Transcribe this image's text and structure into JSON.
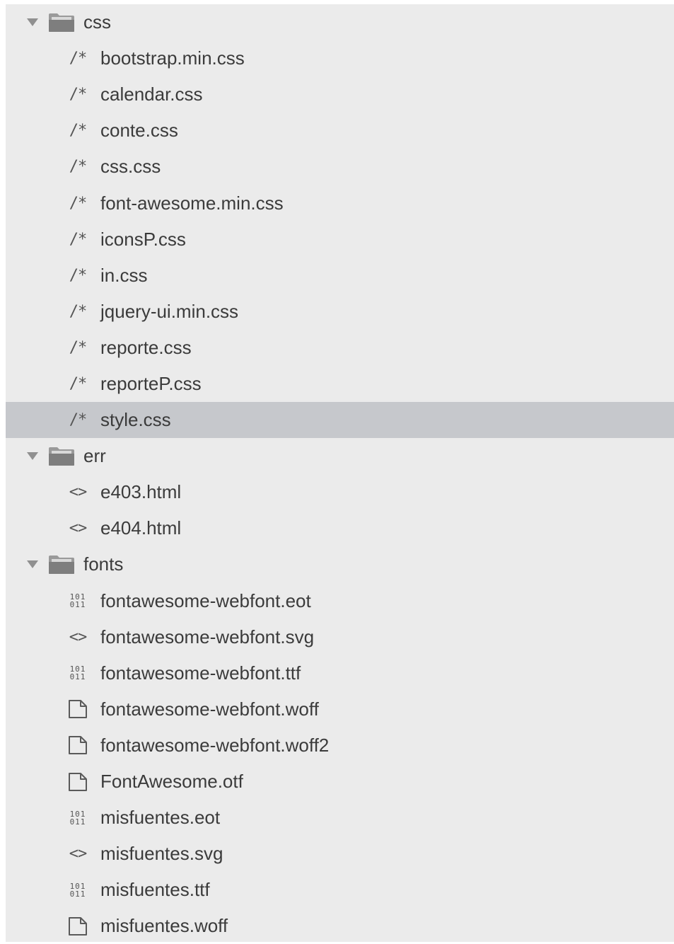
{
  "tree": [
    {
      "kind": "folder",
      "label": "css",
      "icon": "folder-icon",
      "expanded": true
    },
    {
      "kind": "file",
      "label": "bootstrap.min.css",
      "icon": "css-comment-icon",
      "glyph": "/*"
    },
    {
      "kind": "file",
      "label": "calendar.css",
      "icon": "css-comment-icon",
      "glyph": "/*"
    },
    {
      "kind": "file",
      "label": "conte.css",
      "icon": "css-comment-icon",
      "glyph": "/*"
    },
    {
      "kind": "file",
      "label": "css.css",
      "icon": "css-comment-icon",
      "glyph": "/*"
    },
    {
      "kind": "file",
      "label": "font-awesome.min.css",
      "icon": "css-comment-icon",
      "glyph": "/*"
    },
    {
      "kind": "file",
      "label": "iconsP.css",
      "icon": "css-comment-icon",
      "glyph": "/*"
    },
    {
      "kind": "file",
      "label": "in.css",
      "icon": "css-comment-icon",
      "glyph": "/*"
    },
    {
      "kind": "file",
      "label": "jquery-ui.min.css",
      "icon": "css-comment-icon",
      "glyph": "/*"
    },
    {
      "kind": "file",
      "label": "reporte.css",
      "icon": "css-comment-icon",
      "glyph": "/*"
    },
    {
      "kind": "file",
      "label": "reporteP.css",
      "icon": "css-comment-icon",
      "glyph": "/*"
    },
    {
      "kind": "file",
      "label": "style.css",
      "icon": "css-comment-icon",
      "glyph": "/*",
      "selected": true
    },
    {
      "kind": "folder",
      "label": "err",
      "icon": "folder-icon",
      "expanded": true
    },
    {
      "kind": "file",
      "label": "e403.html",
      "icon": "code-brackets-icon",
      "glyph": "<>"
    },
    {
      "kind": "file",
      "label": "e404.html",
      "icon": "code-brackets-icon",
      "glyph": "<>"
    },
    {
      "kind": "folder",
      "label": "fonts",
      "icon": "folder-icon",
      "expanded": true
    },
    {
      "kind": "file",
      "label": "fontawesome-webfont.eot",
      "icon": "binary-file-icon",
      "glyph": "101\n011"
    },
    {
      "kind": "file",
      "label": "fontawesome-webfont.svg",
      "icon": "code-brackets-icon",
      "glyph": "<>"
    },
    {
      "kind": "file",
      "label": "fontawesome-webfont.ttf",
      "icon": "binary-file-icon",
      "glyph": "101\n011"
    },
    {
      "kind": "file",
      "label": "fontawesome-webfont.woff",
      "icon": "generic-file-icon"
    },
    {
      "kind": "file",
      "label": "fontawesome-webfont.woff2",
      "icon": "generic-file-icon"
    },
    {
      "kind": "file",
      "label": "FontAwesome.otf",
      "icon": "generic-file-icon"
    },
    {
      "kind": "file",
      "label": "misfuentes.eot",
      "icon": "binary-file-icon",
      "glyph": "101\n011"
    },
    {
      "kind": "file",
      "label": "misfuentes.svg",
      "icon": "code-brackets-icon",
      "glyph": "<>"
    },
    {
      "kind": "file",
      "label": "misfuentes.ttf",
      "icon": "binary-file-icon",
      "glyph": "101\n011"
    },
    {
      "kind": "file",
      "label": "misfuentes.woff",
      "icon": "generic-file-icon"
    }
  ],
  "colors": {
    "panel_bg": "#ebebeb",
    "selected_bg": "#c6c8cc",
    "text": "#3b3b3b",
    "icon": "#5a5a5a",
    "folder": "#8a8a8a"
  }
}
